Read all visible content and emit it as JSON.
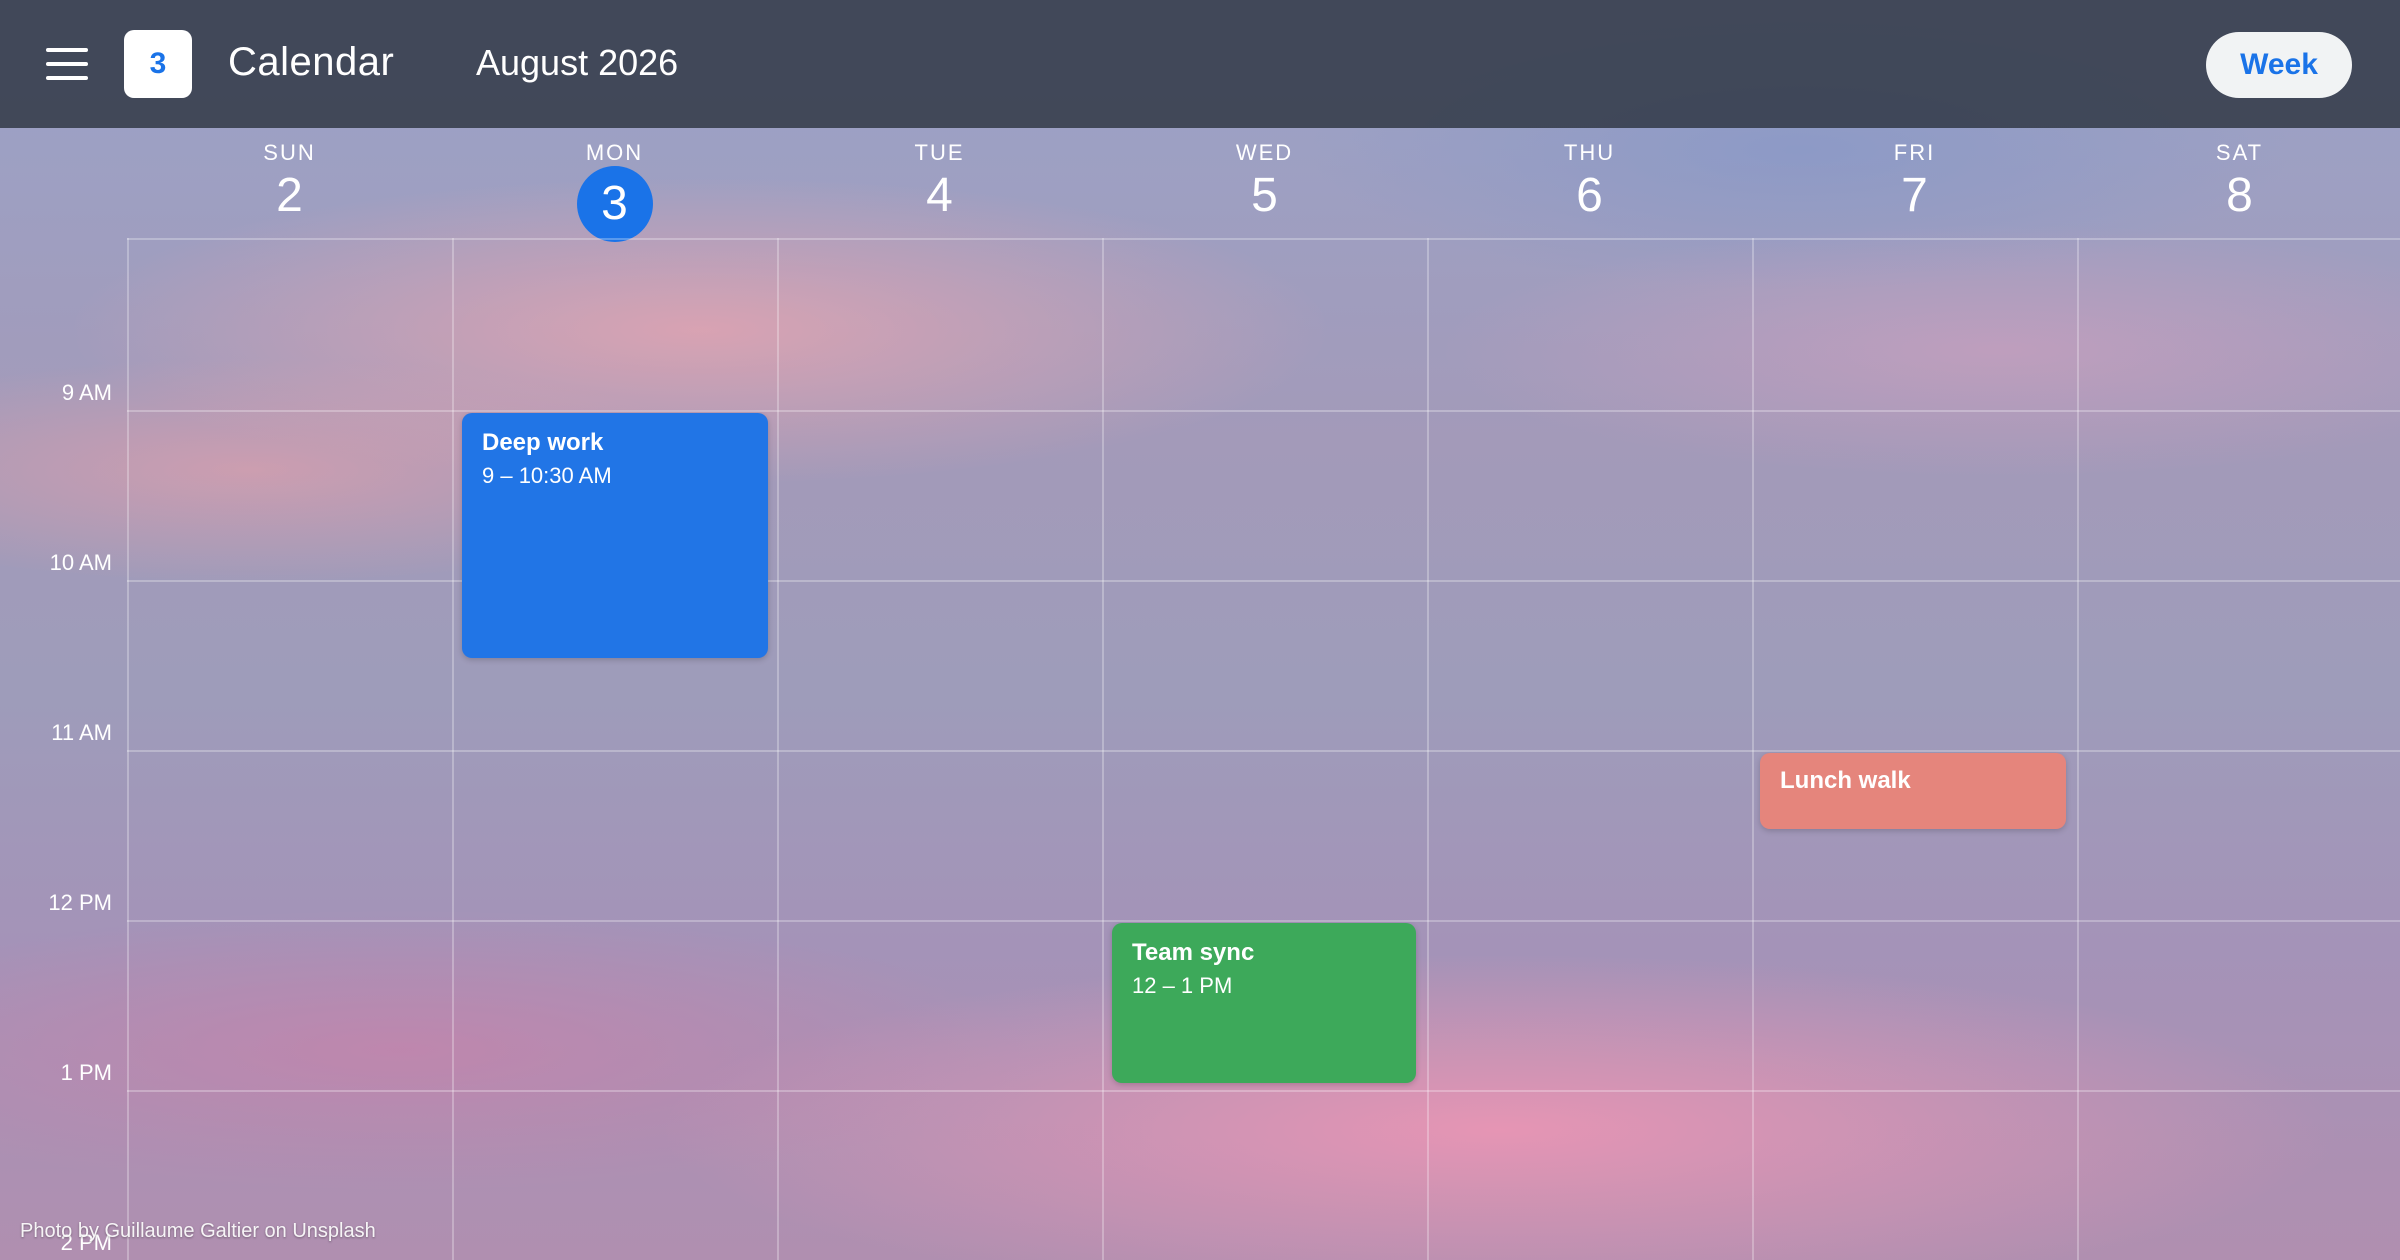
{
  "header": {
    "menu_icon": "hamburger-menu-icon",
    "logo_day": "3",
    "app_title": "Calendar",
    "month_title": "August 2026",
    "view_button_label": "Week"
  },
  "days": [
    {
      "name": "SUN",
      "num": "2",
      "today": false
    },
    {
      "name": "MON",
      "num": "3",
      "today": true
    },
    {
      "name": "TUE",
      "num": "4",
      "today": false
    },
    {
      "name": "WED",
      "num": "5",
      "today": false
    },
    {
      "name": "THU",
      "num": "6",
      "today": false
    },
    {
      "name": "FRI",
      "num": "7",
      "today": false
    },
    {
      "name": "SAT",
      "num": "8",
      "today": false
    }
  ],
  "time_labels": [
    "9 AM",
    "10 AM",
    "11 AM",
    "12 PM",
    "1 PM",
    "2 PM"
  ],
  "events": [
    {
      "title": "Deep work",
      "time": "9 – 10:30 AM",
      "day": "MON",
      "color": "#2175e6"
    },
    {
      "title": "Team sync",
      "time": "12 – 1 PM",
      "day": "WED",
      "color": "#3da95a"
    },
    {
      "title": "Lunch walk",
      "time": "",
      "day": "FRI",
      "color": "#e5857c"
    }
  ],
  "colors": {
    "accent": "#1a73e8",
    "header_bg": "#2d3441"
  },
  "photo_credit": "Photo by Guillaume Galtier on Unsplash"
}
